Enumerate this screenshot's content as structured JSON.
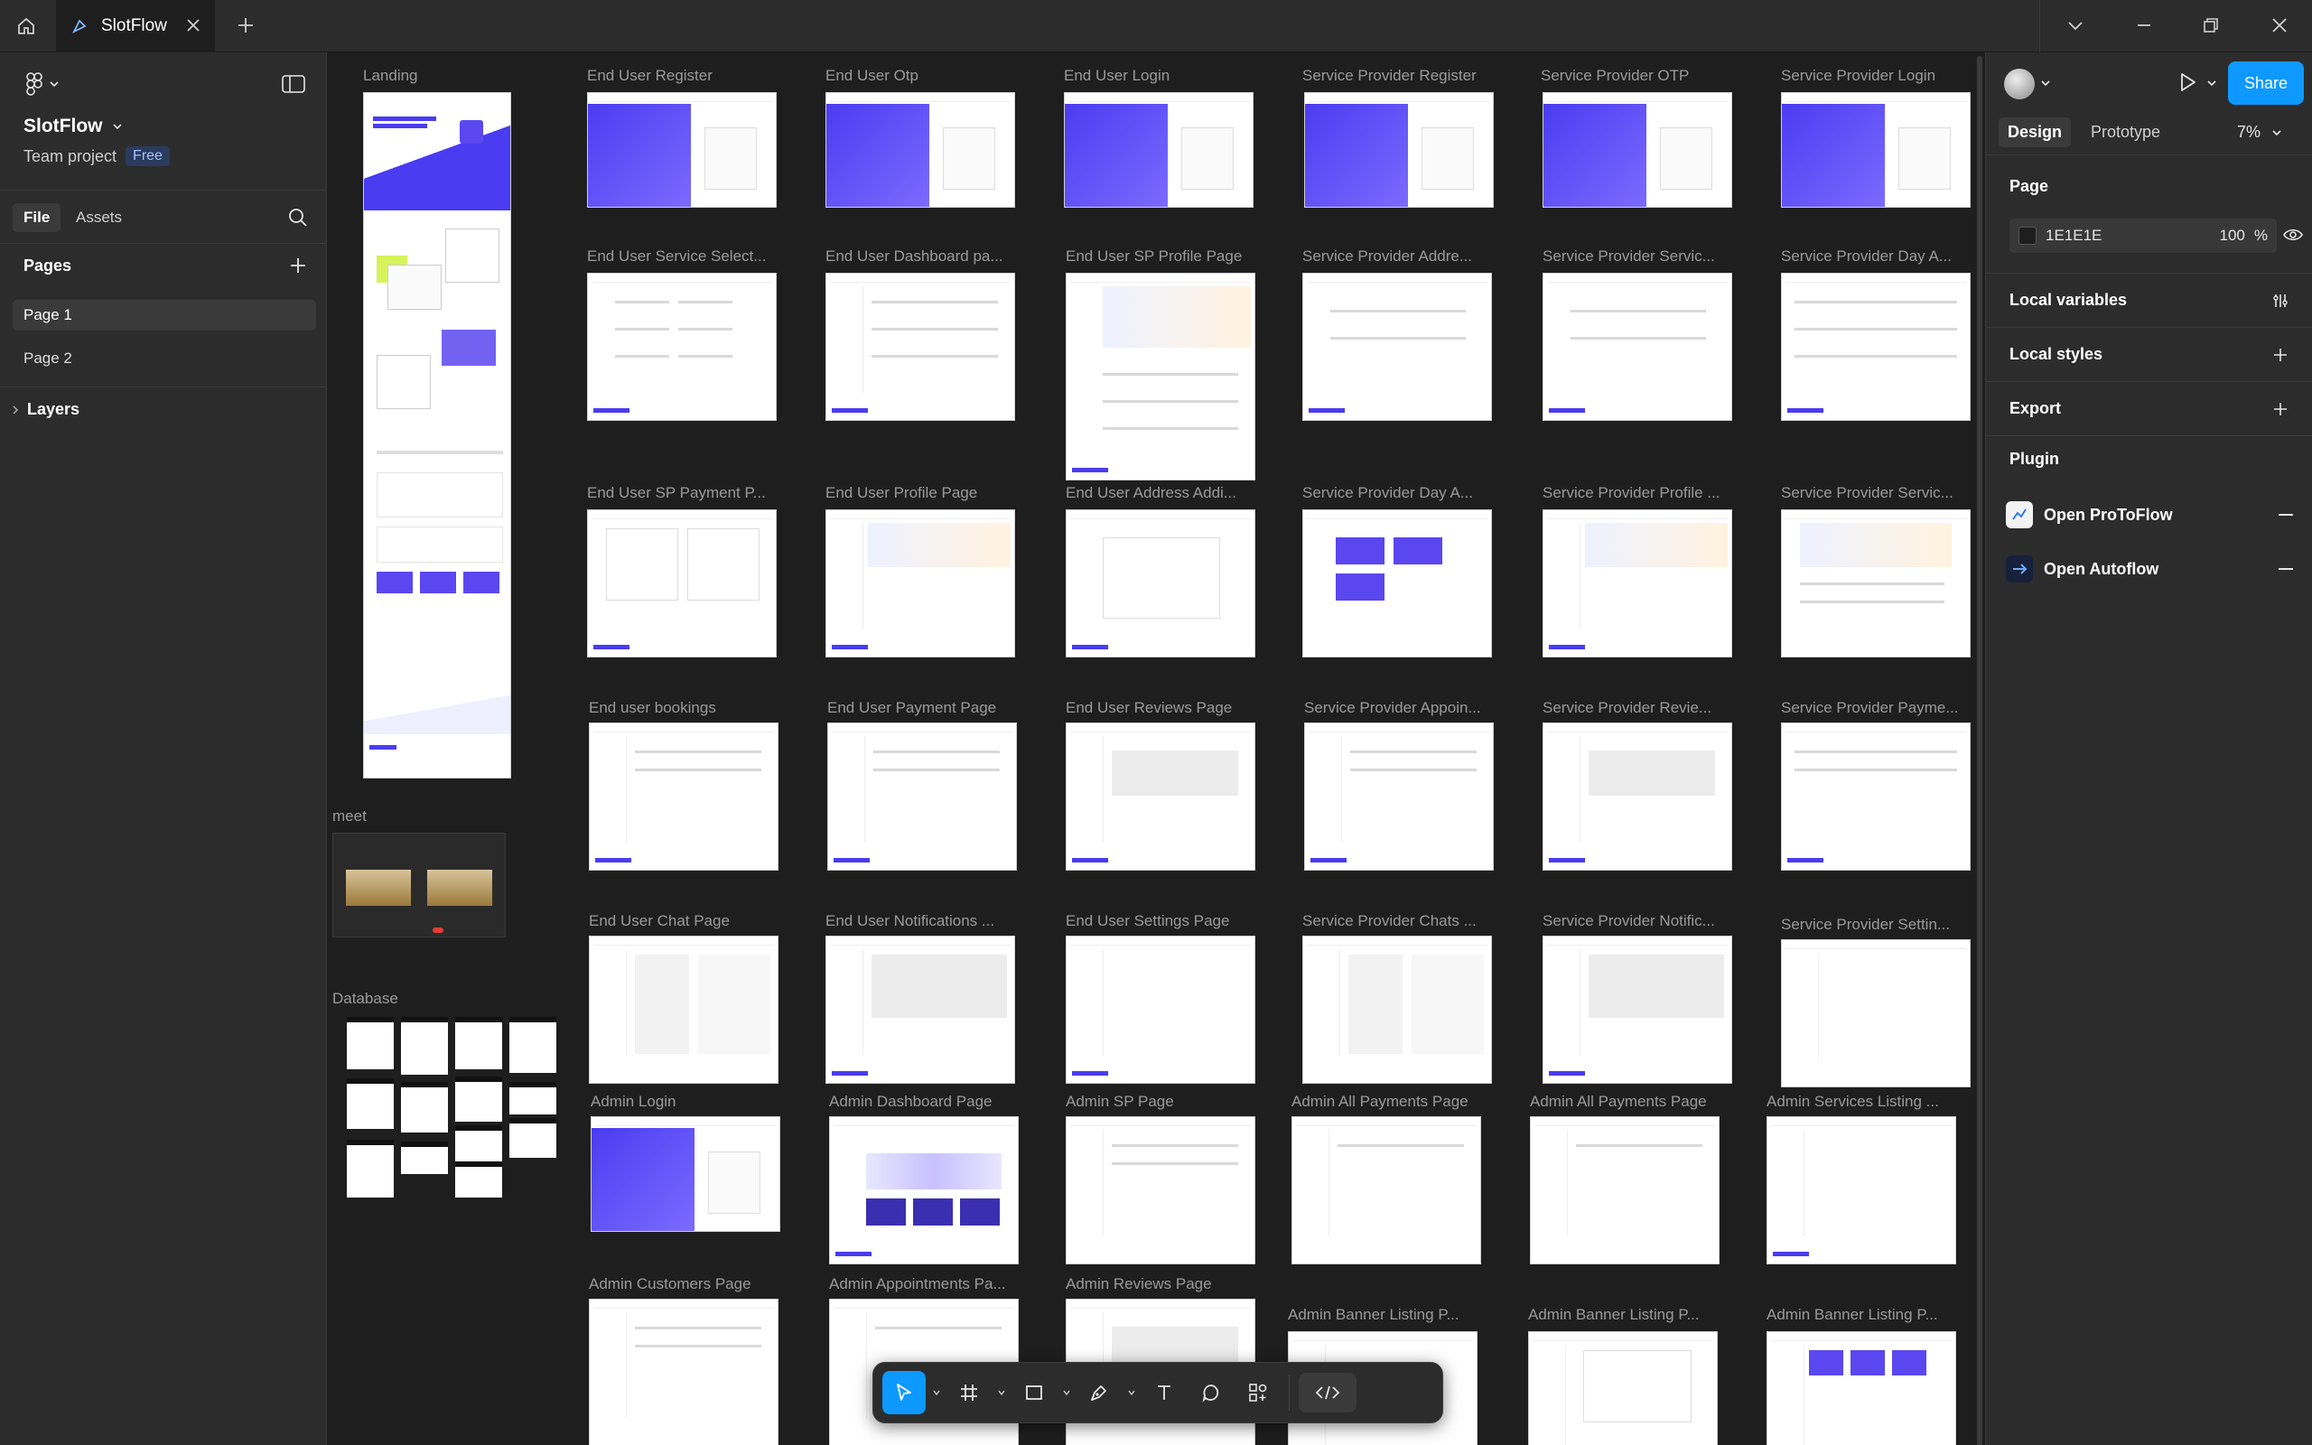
{
  "titlebar": {
    "tab_title": "SlotFlow"
  },
  "left_panel": {
    "file_name": "SlotFlow",
    "team": "Team project",
    "plan_badge": "Free",
    "tabs": [
      "File",
      "Assets"
    ],
    "pages_title": "Pages",
    "pages": [
      "Page 1",
      "Page 2"
    ],
    "layers_title": "Layers"
  },
  "canvas": {
    "frames": [
      {
        "label": "Landing"
      },
      {
        "label": "meet"
      },
      {
        "label": "Database"
      },
      {
        "label": "End User Register"
      },
      {
        "label": "End User Otp"
      },
      {
        "label": "End User Login"
      },
      {
        "label": "Service Provider Register"
      },
      {
        "label": "Service Provider OTP"
      },
      {
        "label": "Service Provider Login"
      },
      {
        "label": "End User Service Select..."
      },
      {
        "label": "End User Dashboard pa..."
      },
      {
        "label": "End User SP Profile Page"
      },
      {
        "label": "Service Provider Addre..."
      },
      {
        "label": "Service Provider Servic..."
      },
      {
        "label": "Service Provider Day A..."
      },
      {
        "label": "End User SP Payment P..."
      },
      {
        "label": "End User Profile Page"
      },
      {
        "label": "End User Address Addi..."
      },
      {
        "label": "Service Provider Day A..."
      },
      {
        "label": "Service Provider Profile ..."
      },
      {
        "label": "Service Provider Servic..."
      },
      {
        "label": "End user bookings"
      },
      {
        "label": "End User Payment Page"
      },
      {
        "label": "End User Reviews Page"
      },
      {
        "label": "Service Provider Appoin..."
      },
      {
        "label": "Service Provider Revie..."
      },
      {
        "label": "Service Provider Payme..."
      },
      {
        "label": "End User Chat Page"
      },
      {
        "label": "End User Notifications ..."
      },
      {
        "label": "End User Settings Page"
      },
      {
        "label": "Service Provider Chats ..."
      },
      {
        "label": "Service Provider Notific..."
      },
      {
        "label": "Service Provider Settin..."
      },
      {
        "label": "Admin Login"
      },
      {
        "label": "Admin Dashboard Page"
      },
      {
        "label": "Admin SP Page"
      },
      {
        "label": "Admin All Payments Page"
      },
      {
        "label": "Admin All Payments Page"
      },
      {
        "label": "Admin Services Listing ..."
      },
      {
        "label": "Admin Customers Page"
      },
      {
        "label": "Admin Appointments Pa..."
      },
      {
        "label": "Admin Reviews Page"
      },
      {
        "label": "Admin Banner Listing P..."
      },
      {
        "label": "Admin Banner Listing P..."
      },
      {
        "label": "Admin Banner Listing P..."
      }
    ]
  },
  "toolbar": {
    "tools": [
      "move-tool",
      "frame-tool",
      "shape-tool",
      "pen-tool",
      "text-tool",
      "comment-tool",
      "actions-tool",
      "dev-mode"
    ]
  },
  "right_panel": {
    "share_label": "Share",
    "tabs": [
      "Design",
      "Prototype"
    ],
    "zoom": "7%",
    "page_section": "Page",
    "bg_color": "1E1E1E",
    "bg_opacity": "100",
    "opacity_unit": "%",
    "local_variables": "Local variables",
    "local_styles": "Local styles",
    "export": "Export",
    "plugin_section": "Plugin",
    "plugins": [
      "Open ProToFlow",
      "Open Autoflow"
    ]
  },
  "help_label": "?",
  "colors": {
    "accent": "#0d99ff",
    "canvas_bg": "#1e1e1e",
    "panel_bg": "#2c2c2c",
    "brand_purple": "#5a47f0"
  }
}
